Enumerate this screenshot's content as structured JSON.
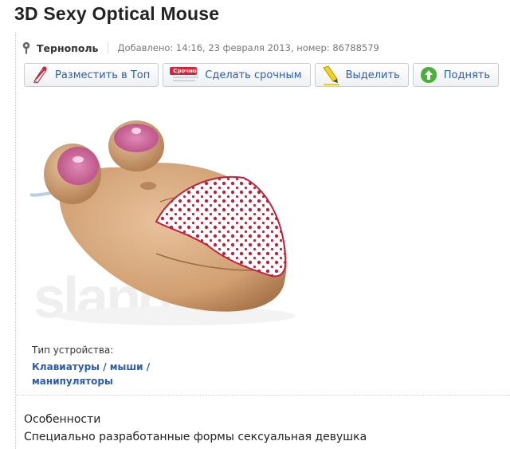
{
  "listing": {
    "title": "3D Sexy Optical Mouse",
    "city": "Тернополь",
    "added_info": "Добавлено: 14:16, 23 февраля 2013, номер: 86788579"
  },
  "actions": [
    {
      "label": "Разместить в Топ",
      "icon": "promote-icon"
    },
    {
      "label": "Сделать срочным",
      "icon": "urgent-icon",
      "badge": "Срочно"
    },
    {
      "label": "Выделить",
      "icon": "highlight-icon"
    },
    {
      "label": "Поднять",
      "icon": "raise-icon"
    }
  ],
  "photo": {
    "watermark": "slando"
  },
  "details": {
    "device_type_label": "Тип устройства:",
    "device_type_value": "Клавиатуры / мыши / манипуляторы"
  },
  "description": {
    "heading": "Особенности",
    "text": "Специально разработанные формы сексуальная девушка"
  },
  "colors": {
    "link": "#2a5db0",
    "mouse_body": "#d6a77a",
    "pattern": "#c0223a"
  }
}
